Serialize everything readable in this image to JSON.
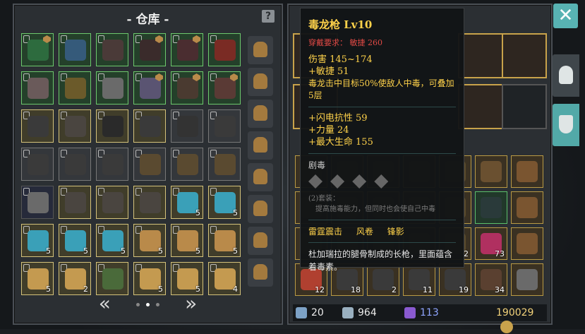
{
  "storage": {
    "title": "仓库",
    "title_prefix": "-",
    "title_suffix": "-",
    "help_glyph": "?",
    "items": [
      {
        "rarity": "green",
        "color": "#2d6b3e",
        "badge": true
      },
      {
        "rarity": "green",
        "color": "#355a7a",
        "badge": false
      },
      {
        "rarity": "green",
        "color": "#4a3a38",
        "badge": false
      },
      {
        "rarity": "green",
        "color": "#3a2b2b",
        "badge": true
      },
      {
        "rarity": "green",
        "color": "#4a2d30",
        "badge": true
      },
      {
        "rarity": "green",
        "color": "#7a2b24",
        "badge": false
      },
      {
        "rarity": "green",
        "color": "#6a5a5a",
        "badge": false
      },
      {
        "rarity": "green",
        "color": "#6b5a2a",
        "badge": false
      },
      {
        "rarity": "green",
        "color": "#6a6a6a",
        "badge": false
      },
      {
        "rarity": "green",
        "color": "#5a5472",
        "badge": true
      },
      {
        "rarity": "green",
        "color": "#4a3a30",
        "badge": true
      },
      {
        "rarity": "green",
        "color": "#5a3a35",
        "badge": true
      },
      {
        "rarity": "gold",
        "color": "#3a3a3a",
        "badge": false
      },
      {
        "rarity": "gold",
        "color": "#4a4540",
        "badge": false
      },
      {
        "rarity": "gold",
        "color": "#2a2a2a",
        "badge": false
      },
      {
        "rarity": "gold",
        "color": "#3a3a3a",
        "badge": false
      },
      {
        "rarity": "gray",
        "color": "#333",
        "badge": false
      },
      {
        "rarity": "gray",
        "color": "#3a3a3a",
        "badge": false
      },
      {
        "rarity": "gray",
        "color": "#3a3a3a",
        "badge": false
      },
      {
        "rarity": "gray",
        "color": "#3a3a3a",
        "badge": false
      },
      {
        "rarity": "gray",
        "color": "#3a3a3a",
        "badge": false
      },
      {
        "rarity": "gray",
        "color": "#5a4a30",
        "badge": false
      },
      {
        "rarity": "gray",
        "color": "#5a4a30",
        "badge": false
      },
      {
        "rarity": "gray",
        "color": "#5a4a30",
        "badge": false
      },
      {
        "rarity": "dblue",
        "color": "#6a6a6a",
        "badge": false
      },
      {
        "rarity": "gold",
        "color": "#4a4540",
        "badge": false
      },
      {
        "rarity": "gold",
        "color": "#4a4540",
        "badge": false
      },
      {
        "rarity": "gold",
        "color": "#4a4540",
        "badge": false
      },
      {
        "rarity": "gold",
        "color": "#3aa0b8",
        "count": "5"
      },
      {
        "rarity": "gold",
        "color": "#3aa0b8",
        "count": "5"
      },
      {
        "rarity": "gold",
        "color": "#3aa0b8",
        "count": "5"
      },
      {
        "rarity": "gold",
        "color": "#3aa0b8",
        "count": "5"
      },
      {
        "rarity": "gold",
        "color": "#3aa0b8",
        "count": "5"
      },
      {
        "rarity": "gold",
        "color": "#b98a4a",
        "count": "5"
      },
      {
        "rarity": "gold",
        "color": "#b98a4a",
        "count": "5"
      },
      {
        "rarity": "gold",
        "color": "#b98a4a",
        "count": "5"
      },
      {
        "rarity": "gold",
        "color": "#c49a50",
        "count": "5"
      },
      {
        "rarity": "gold",
        "color": "#c49a50",
        "count": "2"
      },
      {
        "rarity": "gold",
        "color": "#4a6a3a",
        "count": ""
      },
      {
        "rarity": "gold",
        "color": "#c49a50",
        "count": "5"
      },
      {
        "rarity": "gold",
        "color": "#c49a50",
        "count": "5"
      },
      {
        "rarity": "gold",
        "color": "#c49a50",
        "count": "4"
      }
    ],
    "pager": {
      "prev": "«",
      "next": "»",
      "dots": [
        false,
        true,
        false
      ]
    }
  },
  "tooltip": {
    "name": "毒龙枪  Lv10",
    "requirement": "穿戴要求：  敏捷 260",
    "stats": [
      "伤害  145~174",
      "+敏捷 51"
    ],
    "effect": "毒龙击中目标50%使敌人中毒，可叠加5层",
    "bonus": [
      "+闪电抗性  59",
      "+力量 24",
      "+最大生命 155"
    ],
    "set_title": "剧毒",
    "set_desc": "(2)套装：\n　提高施毒能力，但同时也会使自己中毒",
    "skills": [
      "雷霆震击",
      "风卷",
      "锋影"
    ],
    "flavor": "杜加瑞拉的腿骨制成的长枪，里面蕴含着毒素。"
  },
  "inventory": {
    "items": [
      {
        "rarity": "gold",
        "color": "#5a4a2a",
        "count": ""
      },
      {
        "rarity": "gold",
        "color": "#5a4a2a",
        "count": ""
      },
      {
        "rarity": "gold",
        "color": "#5a4a2a",
        "count": ""
      },
      {
        "rarity": "gold",
        "color": "#5a4a2a",
        "count": ""
      },
      {
        "rarity": "gold",
        "color": "#5a4a2a",
        "count": ""
      },
      {
        "rarity": "gold",
        "color": "#6a5030",
        "count": ""
      },
      {
        "rarity": "gold",
        "color": "#7a5530",
        "count": ""
      },
      {
        "rarity": "gold",
        "color": "#5a4a2a",
        "count": ""
      },
      {
        "rarity": "gold",
        "color": "#5a4a2a",
        "count": ""
      },
      {
        "rarity": "gold",
        "color": "#5a4a2a",
        "count": ""
      },
      {
        "rarity": "gold",
        "color": "#5a4a2a",
        "count": ""
      },
      {
        "rarity": "gold",
        "color": "#5a4a2a",
        "count": ""
      },
      {
        "rarity": "green",
        "color": "#2a3a3a",
        "count": ""
      },
      {
        "rarity": "gold",
        "color": "#7a5530",
        "count": ""
      },
      {
        "rarity": "gold",
        "color": "#5a4a2a",
        "count": ""
      },
      {
        "rarity": "gold",
        "color": "#5a4a2a",
        "count": ""
      },
      {
        "rarity": "gold",
        "color": "#5a4a2a",
        "count": ""
      },
      {
        "rarity": "gold",
        "color": "#5a4a2a",
        "count": ""
      },
      {
        "rarity": "gold",
        "color": "#5a4a2a",
        "count": "2"
      },
      {
        "rarity": "gold",
        "color": "#b03060",
        "count": "73"
      },
      {
        "rarity": "gold",
        "color": "#7a5530",
        "count": ""
      },
      {
        "rarity": "gold",
        "color": "#b04030",
        "count": "12"
      },
      {
        "rarity": "gold",
        "color": "#3a3a3a",
        "count": "18"
      },
      {
        "rarity": "gold",
        "color": "#3a3a3a",
        "count": "2"
      },
      {
        "rarity": "gold",
        "color": "#3a3a3a",
        "count": "11"
      },
      {
        "rarity": "gold",
        "color": "#3a3a3a",
        "count": "19"
      },
      {
        "rarity": "gold",
        "color": "#5a4030",
        "count": "34"
      },
      {
        "rarity": "gold",
        "color": "#6a6a6a",
        "count": ""
      }
    ]
  },
  "footer": {
    "attack": "20",
    "defense": "964",
    "gems": "113",
    "gold": "190029"
  },
  "close_glyph": "✕"
}
